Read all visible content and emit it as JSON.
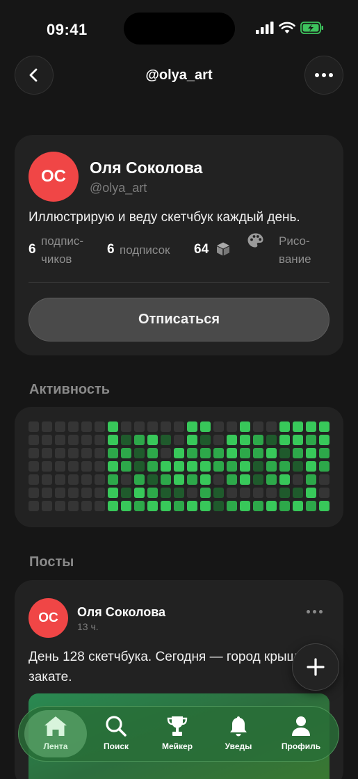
{
  "status_bar": {
    "time": "09:41"
  },
  "header": {
    "title": "@olya_art"
  },
  "profile": {
    "avatar_initials": "OC",
    "name": "Оля Соколова",
    "handle": "@olya_art",
    "bio": "Иллюстрирую и веду скетчбук каждый день.",
    "followers_count": "6",
    "followers_label_1": "подпис-",
    "followers_label_2": "чиков",
    "following_count": "6",
    "following_label": "подписок",
    "boxes_count": "64",
    "boxes_icon": "box-icon",
    "category_icon": "palette-icon",
    "category_label_1": "Рисо-",
    "category_label_2": "вание",
    "unsubscribe_label": "Отписаться"
  },
  "activity": {
    "title": "Активность",
    "colors": {
      "empty": "#353535",
      "low": "#1f5a2c",
      "mid": "#2da84a",
      "high": "#38c85a"
    },
    "weeks": [
      [
        0,
        0,
        0,
        0,
        0,
        0,
        0
      ],
      [
        0,
        0,
        0,
        0,
        0,
        0,
        0
      ],
      [
        0,
        0,
        0,
        0,
        0,
        0,
        0
      ],
      [
        0,
        0,
        0,
        0,
        0,
        0,
        0
      ],
      [
        0,
        0,
        0,
        0,
        0,
        0,
        0
      ],
      [
        0,
        0,
        0,
        0,
        0,
        0,
        0
      ],
      [
        3,
        3,
        2,
        3,
        2,
        3,
        3
      ],
      [
        0,
        1,
        2,
        2,
        0,
        1,
        3
      ],
      [
        0,
        2,
        1,
        1,
        2,
        3,
        2
      ],
      [
        0,
        3,
        2,
        2,
        1,
        2,
        3
      ],
      [
        0,
        1,
        0,
        3,
        2,
        1,
        3
      ],
      [
        0,
        0,
        3,
        3,
        3,
        1,
        2
      ],
      [
        3,
        3,
        2,
        3,
        2,
        0,
        3
      ],
      [
        3,
        1,
        2,
        3,
        3,
        2,
        3
      ],
      [
        0,
        0,
        2,
        2,
        0,
        1,
        1
      ],
      [
        0,
        3,
        3,
        2,
        2,
        0,
        2
      ],
      [
        3,
        3,
        2,
        3,
        3,
        0,
        3
      ],
      [
        0,
        2,
        2,
        1,
        1,
        0,
        2
      ],
      [
        0,
        1,
        3,
        2,
        2,
        0,
        3
      ],
      [
        3,
        3,
        1,
        2,
        3,
        1,
        2
      ],
      [
        3,
        3,
        2,
        1,
        0,
        1,
        3
      ],
      [
        3,
        2,
        3,
        3,
        2,
        3,
        2
      ],
      [
        3,
        3,
        2,
        2,
        0,
        0,
        3
      ]
    ]
  },
  "posts_section": {
    "title": "Посты"
  },
  "post": {
    "avatar_initials": "OC",
    "author": "Оля Соколова",
    "time": "13 ч.",
    "text": "День 128 скетчбука. Сегодня — город крыши на закате."
  },
  "fab": {
    "icon": "plus-icon"
  },
  "tab_bar": {
    "tabs": [
      {
        "label": "Лента",
        "icon": "home-icon",
        "active": true
      },
      {
        "label": "Поиск",
        "icon": "search-icon",
        "active": false
      },
      {
        "label": "Мейкер",
        "icon": "trophy-icon",
        "active": false
      },
      {
        "label": "Уведы",
        "icon": "bell-icon",
        "active": false
      },
      {
        "label": "Профиль",
        "icon": "profile-icon",
        "active": false
      }
    ]
  }
}
